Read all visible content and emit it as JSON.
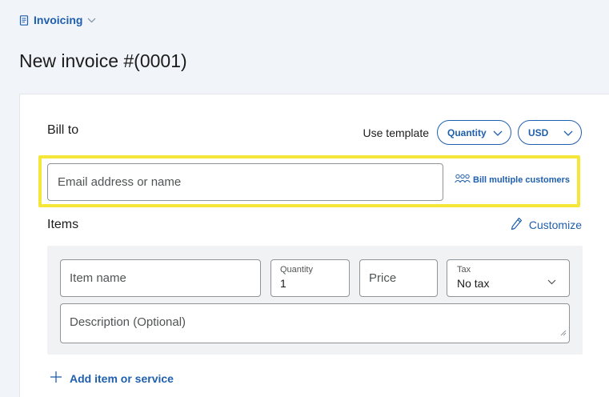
{
  "header": {
    "section_label": "Invoicing",
    "page_title": "New invoice #(0001)"
  },
  "bill_to": {
    "label": "Bill to",
    "email_placeholder": "Email address or name",
    "email_value": "",
    "bill_multiple_label": "Bill multiple customers"
  },
  "template": {
    "label": "Use template",
    "template_selected": "Quantity",
    "currency_selected": "USD"
  },
  "items": {
    "label": "Items",
    "customize_label": "Customize",
    "item_name_placeholder": "Item name",
    "quantity_label": "Quantity",
    "quantity_value": "1",
    "price_placeholder": "Price",
    "tax_label": "Tax",
    "tax_value": "No tax",
    "description_placeholder": "Description (Optional)",
    "add_item_label": "Add item or service"
  },
  "colors": {
    "accent": "#1f5fad",
    "highlight": "#f5e63a",
    "background": "#f1f4f9"
  },
  "icons": {
    "section": "document-icon",
    "dropdown": "chevron-down-icon",
    "multiple_customers": "people-group-icon",
    "customize": "pencil-icon",
    "add": "plus-icon"
  }
}
